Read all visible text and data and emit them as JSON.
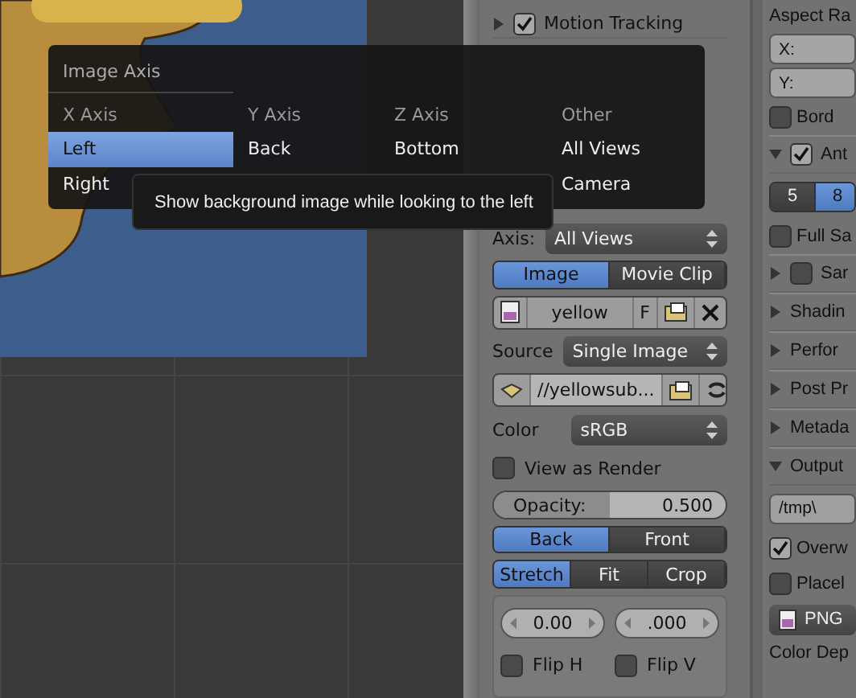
{
  "image_axis_menu": {
    "title": "Image Axis",
    "columns": [
      {
        "heading": "X Axis",
        "items": [
          {
            "label": "Left",
            "selected": true
          },
          {
            "label": "Right",
            "selected": false
          }
        ]
      },
      {
        "heading": "Y Axis",
        "items": [
          {
            "label": "Back",
            "selected": false
          }
        ]
      },
      {
        "heading": "Z Axis",
        "items": [
          {
            "label": "Bottom",
            "selected": false
          }
        ]
      },
      {
        "heading": "Other",
        "items": [
          {
            "label": "All Views",
            "selected": false
          },
          {
            "label": "Camera",
            "selected": false
          }
        ]
      }
    ]
  },
  "tooltip": "Show background image while looking to the left",
  "properties": {
    "motion_tracking": {
      "label": "Motion Tracking",
      "checked": true,
      "expanded": false
    },
    "axis": {
      "label": "Axis:",
      "value": "All Views"
    },
    "source_type": [
      {
        "label": "Image",
        "selected": true
      },
      {
        "label": "Movie Clip",
        "selected": false
      }
    ],
    "image_block": {
      "name": "yellow",
      "fake_user": "F"
    },
    "source": {
      "label": "Source",
      "value": "Single Image"
    },
    "filepath": "//yellowsub...",
    "color": {
      "label": "Color",
      "value": "sRGB"
    },
    "view_as_render": {
      "label": "View as Render",
      "checked": false
    },
    "opacity": {
      "label": "Opacity:",
      "value": "0.500",
      "level": 0.5
    },
    "draw_order": [
      {
        "label": "Back",
        "selected": true
      },
      {
        "label": "Front",
        "selected": false
      }
    ],
    "frame_method": [
      {
        "label": "Stretch",
        "selected": true
      },
      {
        "label": "Fit",
        "selected": false
      },
      {
        "label": "Crop",
        "selected": false
      }
    ],
    "offsets": [
      "0.00",
      ".000"
    ],
    "flips": [
      {
        "label": "Flip H",
        "checked": false
      },
      {
        "label": "Flip V",
        "checked": false
      }
    ]
  },
  "render_panel": [
    {
      "kind": "label",
      "label": "Aspect Ra"
    },
    {
      "kind": "field",
      "label": "X:"
    },
    {
      "kind": "field",
      "label": "Y:"
    },
    {
      "kind": "checkbox",
      "label": "Bord",
      "checked": false
    },
    {
      "kind": "header",
      "label": "Ant",
      "expanded": true,
      "checked": true
    },
    {
      "kind": "toggle",
      "options": [
        {
          "label": "5",
          "selected": false
        },
        {
          "label": "8",
          "selected": true
        }
      ]
    },
    {
      "kind": "checkbox",
      "label": "Full Sa",
      "checked": false
    },
    {
      "kind": "header",
      "label": "Sar",
      "expanded": false,
      "checked": false
    },
    {
      "kind": "header",
      "label": "Shadin",
      "expanded": false
    },
    {
      "kind": "header",
      "label": "Perfor",
      "expanded": false
    },
    {
      "kind": "header",
      "label": "Post Pr",
      "expanded": false
    },
    {
      "kind": "header",
      "label": "Metada",
      "expanded": false
    },
    {
      "kind": "header",
      "label": "Output",
      "expanded": true
    },
    {
      "kind": "path",
      "label": "/tmp\\"
    },
    {
      "kind": "checkbox",
      "label": "Overw",
      "checked": true
    },
    {
      "kind": "checkbox",
      "label": "Placel",
      "checked": false
    },
    {
      "kind": "format",
      "label": "PNG"
    },
    {
      "kind": "label",
      "label": "Color Dep"
    }
  ]
}
